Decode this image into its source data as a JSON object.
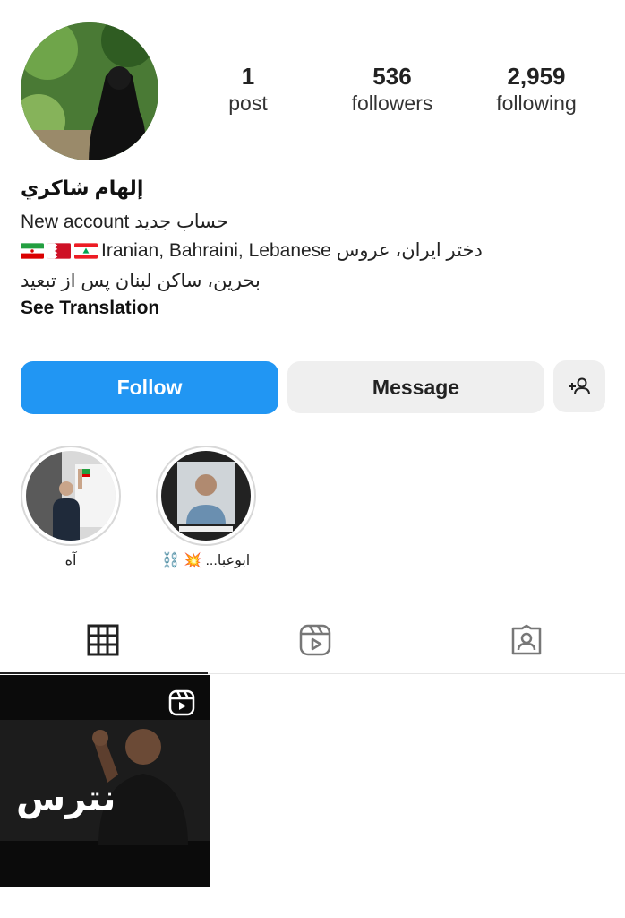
{
  "profile": {
    "name": "إلهام شاكري",
    "posts": {
      "count": "1",
      "label": "post"
    },
    "followers": {
      "count": "536",
      "label": "followers"
    },
    "following": {
      "count": "2,959",
      "label": "following"
    }
  },
  "bio": {
    "line1": "New account حساب جدید",
    "line2_text": "Iranian, Bahraini, Lebanese دختر ایران، عروس",
    "line3": "بحرين، ساكن لبنان پس از تبعيد",
    "see_translation": "See Translation",
    "flags": [
      "iran-flag-icon",
      "bahrain-flag-icon",
      "lebanon-flag-icon"
    ]
  },
  "actions": {
    "follow": "Follow",
    "message": "Message",
    "add_person_icon": "add-person-icon"
  },
  "highlights": [
    {
      "label": "آه"
    },
    {
      "label": "ابوعبا... 💥 ⛓️"
    }
  ],
  "tabs": [
    "grid-icon",
    "reels-icon",
    "tagged-icon"
  ],
  "post": {
    "overlay_text": "نترس",
    "badge_icon": "reel-icon"
  },
  "colors": {
    "accent": "#2196f3",
    "button_bg": "#efefef"
  }
}
